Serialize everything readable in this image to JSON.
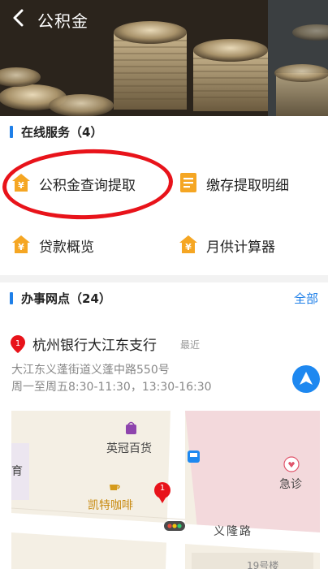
{
  "header": {
    "title": "公积金"
  },
  "online_services": {
    "title": "在线服务（4）",
    "items": [
      {
        "label": "公积金查询提取",
        "icon": "yuan-house-icon"
      },
      {
        "label": "缴存提取明细",
        "icon": "document-list-icon"
      },
      {
        "label": "贷款概览",
        "icon": "yuan-house-icon"
      },
      {
        "label": "月供计算器",
        "icon": "yuan-house-icon"
      }
    ]
  },
  "branches": {
    "title": "办事网点（24）",
    "all_link": "全部",
    "featured": {
      "name": "杭州银行大江东支行",
      "tag": "最近",
      "address": "大江东义蓬街道义蓬中路550号",
      "hours": "周一至周五8:30-11:30，13:30-16:30"
    }
  },
  "map": {
    "labels": {
      "store": "英冠百货",
      "cafe": "凯特咖啡",
      "edu": "教育",
      "emergency": "急诊",
      "road": "义隆路",
      "building": "19号楼"
    },
    "marker_number": "1"
  },
  "colors": {
    "accent": "#1e7fe8",
    "icon_gold": "#f5a623",
    "highlight_circle": "#e8131a"
  }
}
